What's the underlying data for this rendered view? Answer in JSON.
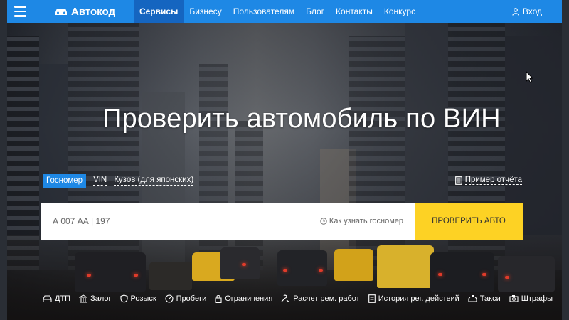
{
  "header": {
    "brand": "Автокод",
    "nav": [
      {
        "label": "Сервисы",
        "active": true
      },
      {
        "label": "Бизнесу",
        "active": false
      },
      {
        "label": "Пользователям",
        "active": false
      },
      {
        "label": "Блог",
        "active": false
      },
      {
        "label": "Контакты",
        "active": false
      },
      {
        "label": "Конкурс",
        "active": false
      }
    ],
    "login": "Вход"
  },
  "hero": {
    "title": "Проверить автомобиль по ВИН"
  },
  "tabs": [
    {
      "label": "Госномер",
      "active": true
    },
    {
      "label": "VIN",
      "active": false
    },
    {
      "label": "Кузов (для японских)",
      "active": false
    }
  ],
  "sample_report": "Пример отчёта",
  "search": {
    "placeholder": "А 007 АА | 197",
    "hint": "Как узнать госномер",
    "button": "ПРОВЕРИТЬ АВТО"
  },
  "services": [
    {
      "label": "ДТП",
      "icon": "accident-icon"
    },
    {
      "label": "Залог",
      "icon": "bank-icon"
    },
    {
      "label": "Розыск",
      "icon": "shield-icon"
    },
    {
      "label": "Пробеги",
      "icon": "speedometer-icon"
    },
    {
      "label": "Ограничения",
      "icon": "lock-icon"
    },
    {
      "label": "Расчет рем. работ",
      "icon": "repair-icon"
    },
    {
      "label": "История рег. действий",
      "icon": "document-icon"
    },
    {
      "label": "Такси",
      "icon": "taxi-icon"
    },
    {
      "label": "Штрафы",
      "icon": "camera-icon"
    }
  ],
  "colors": {
    "header": "#1e88e5",
    "active_nav": "#1565c0",
    "button": "#fdd224"
  }
}
